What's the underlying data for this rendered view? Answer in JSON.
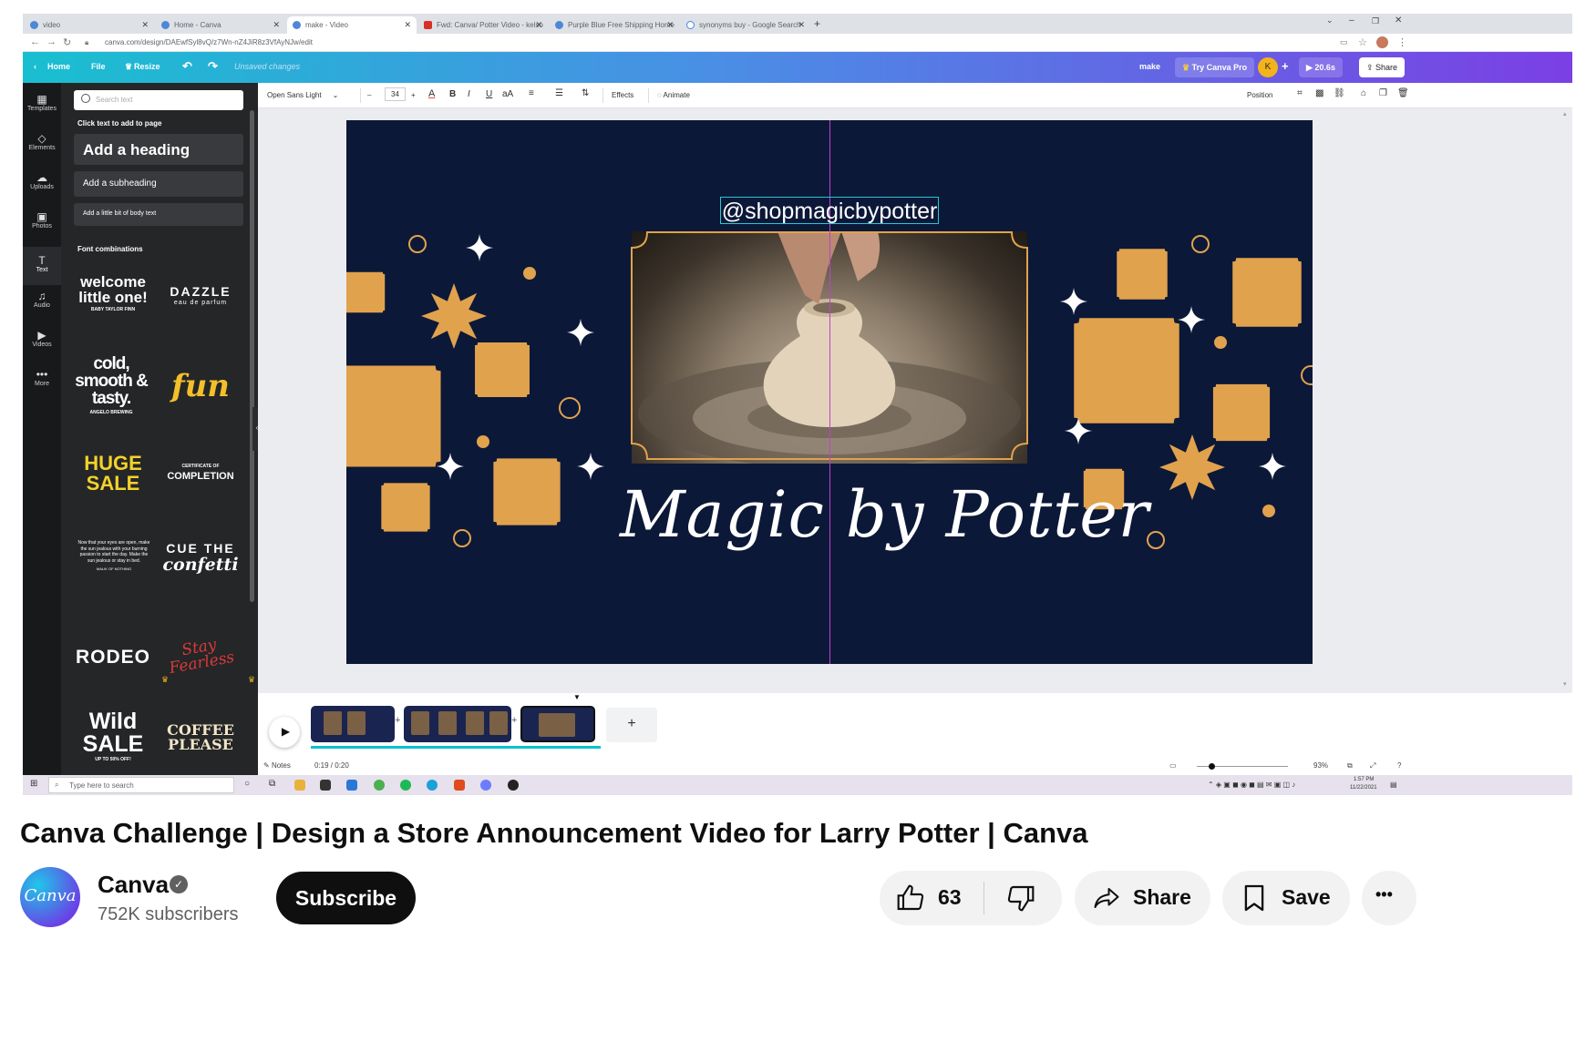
{
  "browser": {
    "tabs": [
      "video",
      "Home - Canva",
      "make - Video",
      "Fwd: Canva/ Potter Video - kelso",
      "Purple Blue Free Shipping Home",
      "synonyms buy - Google Search"
    ],
    "new_tab": "+",
    "url": "canva.com/design/DAEwfSyl8vQ/z7Wn-nZ4JiR8z3VfAyNJw/edit"
  },
  "canva_header": {
    "home": "Home",
    "file": "File",
    "resize": "Resize",
    "unsaved": "Unsaved changes",
    "design_name": "make",
    "try_pro": "Try Canva Pro",
    "avatar_initial": "K",
    "add": "+",
    "duration": "20.6s",
    "share": "Share"
  },
  "rail": {
    "items": [
      "Templates",
      "Elements",
      "Uploads",
      "Photos",
      "Text",
      "Audio",
      "Videos",
      "More"
    ]
  },
  "text_panel": {
    "search_placeholder": "Search text",
    "click_label": "Click text to add to page",
    "heading": "Add a heading",
    "subheading": "Add a subheading",
    "body": "Add a little bit of body text",
    "font_combinations_label": "Font combinations",
    "combos": [
      {
        "main": "welcome little one!",
        "sub": "BABY TAYLOR FINN"
      },
      {
        "main": "DAZZLE",
        "sub": "eau de parfum"
      },
      {
        "main": "cold, smooth & tasty.",
        "sub": "ANGELO BREWING"
      },
      {
        "main": "fun",
        "sub": ""
      },
      {
        "main": "HUGE SALE",
        "sub": ""
      },
      {
        "main": "COMPLETION",
        "sub": "CERTIFICATE OF"
      },
      {
        "main": "Now that your eyes are open, make the sun jealous with your burning passion to start the day. Make the sun jealous or stay in bed.",
        "sub": "MALIK OF NOTHING"
      },
      {
        "main": "CUE THE",
        "sub": "confetti"
      },
      {
        "main": "RODEO",
        "sub": ""
      },
      {
        "main": "Stay Fearless",
        "sub": ""
      },
      {
        "main": "Wild SALE",
        "sub": "UP TO 50% OFF!"
      },
      {
        "main": "COFFEE PLEASE",
        "sub": ""
      }
    ]
  },
  "toolbar": {
    "font": "Open Sans Light",
    "minus": "–",
    "font_size": "34",
    "plus": "+",
    "bold": "B",
    "italic": "I",
    "underline": "U",
    "case": "aA",
    "effects": "Effects",
    "animate": "Animate",
    "position": "Position"
  },
  "design": {
    "handle": "@shopmagicbypotter",
    "title": "Magic by Potter"
  },
  "timeline": {
    "add_page": "+",
    "notes": "Notes",
    "time": "0:19 / 0:20",
    "zoom": "93%"
  },
  "taskbar": {
    "search_placeholder": "Type here to search",
    "time": "1:57 PM",
    "date": "11/22/2021"
  },
  "youtube": {
    "title": "Canva Challenge | Design a Store Announcement Video for Larry Potter | Canva",
    "channel": "Canva",
    "avatar_text": "Canva",
    "subscribers": "752K subscribers",
    "subscribe": "Subscribe",
    "likes": "63",
    "share": "Share",
    "save": "Save",
    "more": "•••"
  },
  "colors": {
    "canvas_bg": "#0c1838",
    "accent_gold": "#e0a24d",
    "header_start": "#19bfd0",
    "header_end": "#7b3fe4"
  }
}
